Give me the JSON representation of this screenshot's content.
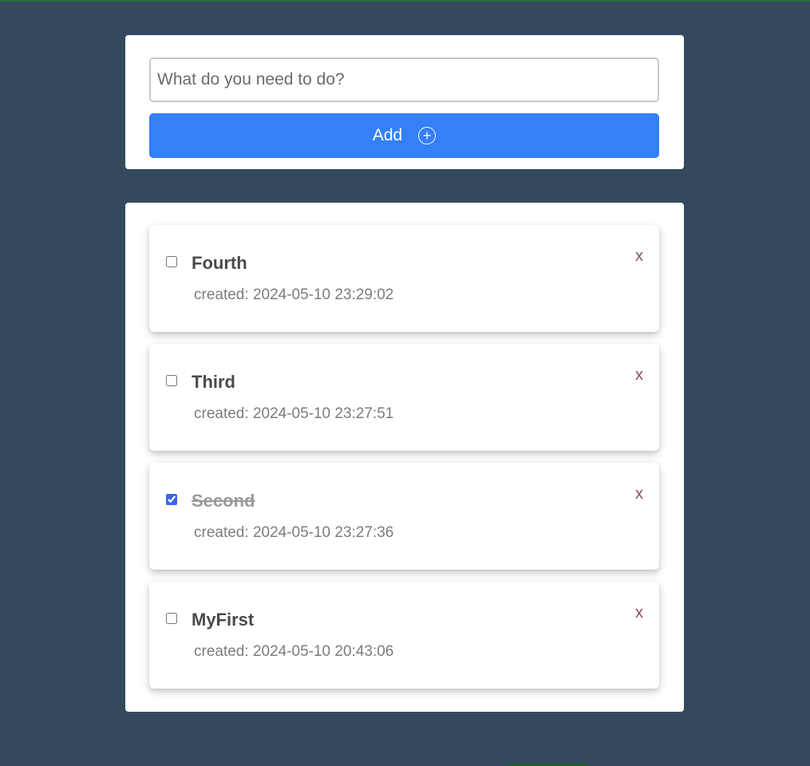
{
  "form": {
    "placeholder": "What do you need to do?",
    "value": "",
    "add_label": "Add",
    "add_icon": "plus-circle-icon"
  },
  "colors": {
    "background": "#34495e",
    "accent": "#3480f6",
    "card": "#ffffff",
    "delete": "#8a4f5a"
  },
  "todos": [
    {
      "title": "Fourth",
      "created_label": "created:",
      "created": "2024-05-10 23:29:02",
      "done": false,
      "delete_label": "x"
    },
    {
      "title": "Third",
      "created_label": "created:",
      "created": "2024-05-10 23:27:51",
      "done": false,
      "delete_label": "x"
    },
    {
      "title": "Second",
      "created_label": "created:",
      "created": "2024-05-10 23:27:36",
      "done": true,
      "delete_label": "x"
    },
    {
      "title": "MyFirst",
      "created_label": "created:",
      "created": "2024-05-10 20:43:06",
      "done": false,
      "delete_label": "x"
    }
  ]
}
